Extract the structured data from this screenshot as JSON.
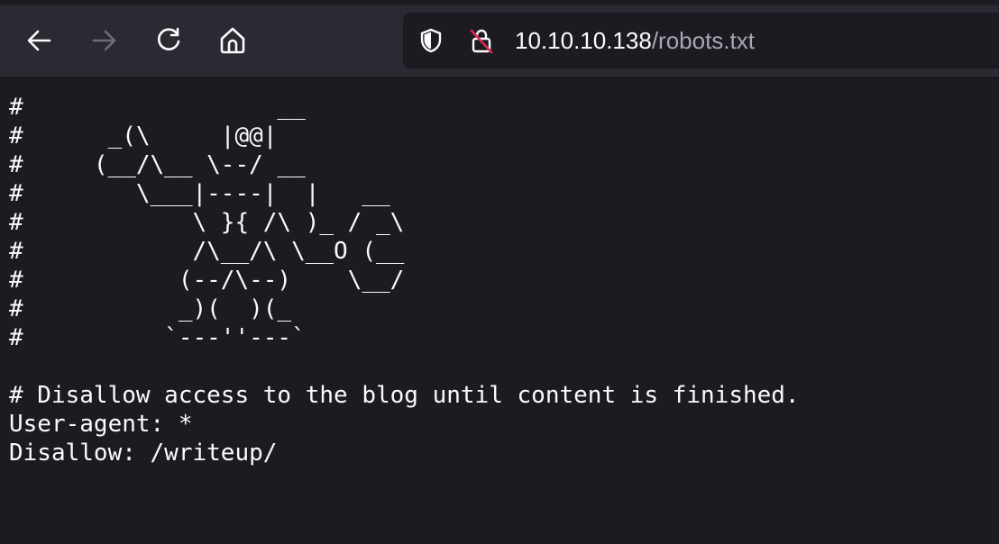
{
  "browser": {
    "icons": {
      "back": "arrow-left-icon",
      "forward": "arrow-right-icon",
      "reload": "reload-icon",
      "home": "home-icon",
      "tracking_protection": "shield-icon",
      "insecure": "crossed-lock-icon"
    },
    "forward_enabled": false,
    "url": {
      "host": "10.10.10.138",
      "path": "/robots.txt"
    }
  },
  "document": {
    "ascii_art": [
      "#                  __",
      "#      _(\\     |@@|",
      "#     (__/\\__ \\--/ __",
      "#        \\___|----|  |   __",
      "#            \\ }{ /\\ )_ / _\\",
      "#            /\\__/\\ \\__O (__",
      "#           (--/\\--)    \\__/",
      "#           _)(  )(_",
      "#          `---''---`"
    ],
    "comment": "# Disallow access to the blog until content is finished.",
    "user_agent": "User-agent: *",
    "disallow": "Disallow: /writeup/"
  },
  "colors": {
    "toolbar_bg": "#2b2a33",
    "content_bg": "#1c1b22",
    "text": "#fbfbfe",
    "insecure_slash": "#e22850"
  }
}
